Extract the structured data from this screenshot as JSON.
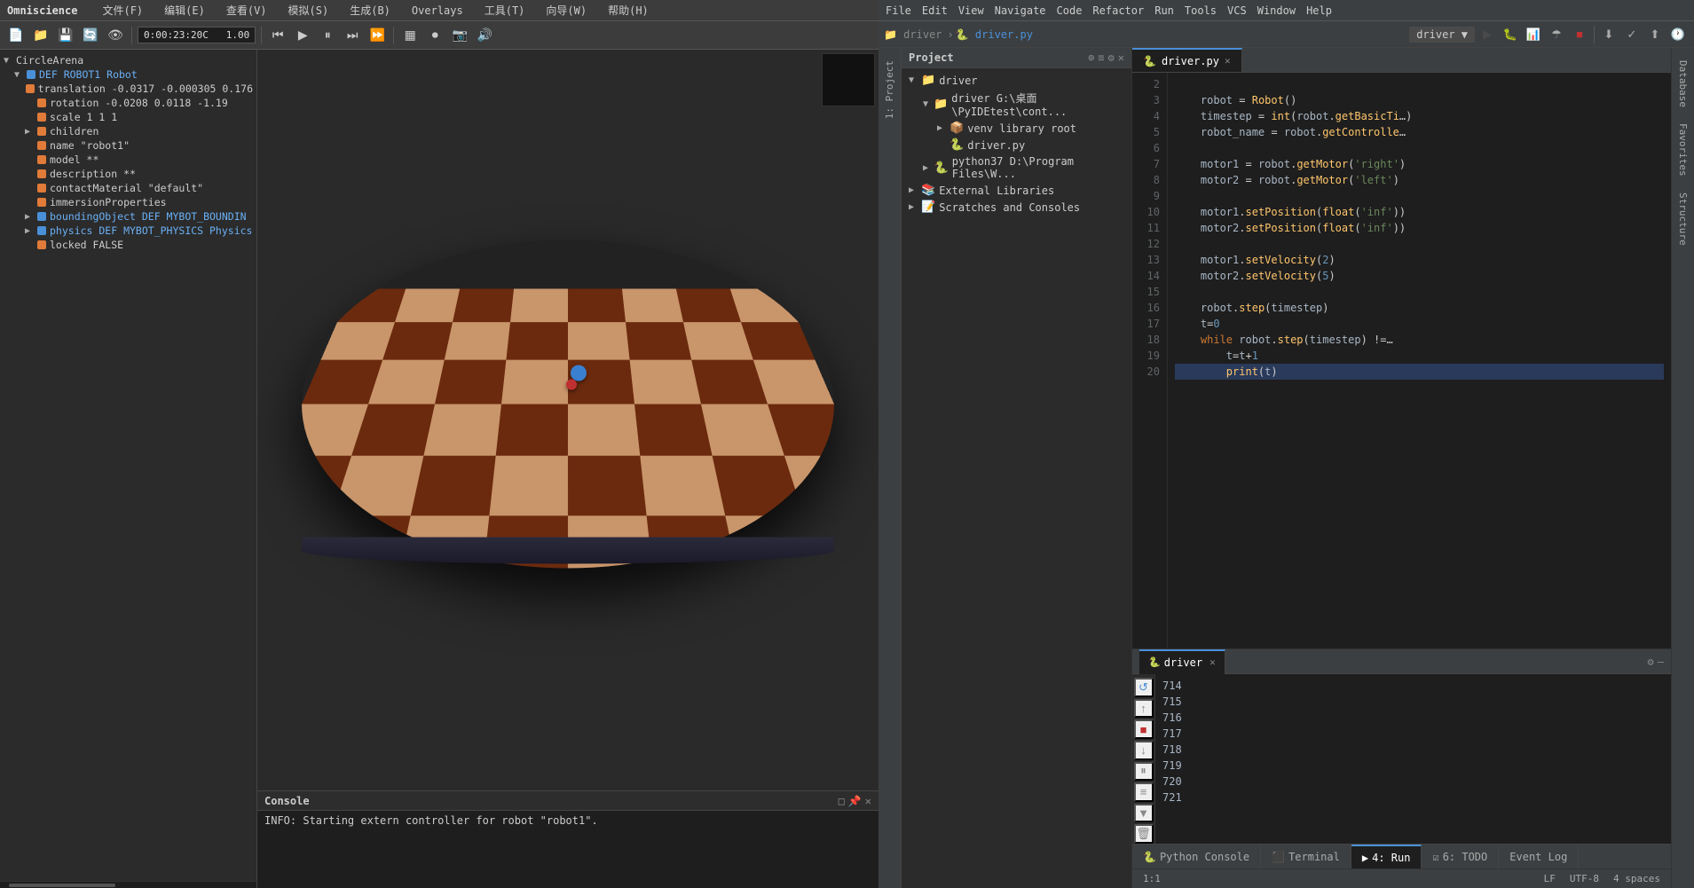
{
  "app": {
    "title": "Omniscience"
  },
  "menu": {
    "items": [
      "文件(F)",
      "编辑(E)",
      "查看(V)",
      "模拟(S)",
      "生成(B)",
      "Overlays",
      "工具(T)",
      "向导(W)",
      "帮助(H)"
    ]
  },
  "toolbar": {
    "time": "0:00:23:20",
    "speed": "1.00"
  },
  "left_tree": {
    "items": [
      {
        "id": "circle-arena",
        "label": "CircleArena",
        "level": 0,
        "arrow": "▼",
        "dot": null,
        "color": "default"
      },
      {
        "id": "def-robot1",
        "label": "DEF ROBOT1 Robot",
        "level": 1,
        "arrow": "▼",
        "dot": "blue",
        "color": "blue"
      },
      {
        "id": "translation",
        "label": "translation -0.0317 -0.000305 0.176",
        "level": 2,
        "arrow": "",
        "dot": "orange",
        "color": "default"
      },
      {
        "id": "rotation",
        "label": "rotation -0.0208 0.0118 -1.19",
        "level": 2,
        "arrow": "",
        "dot": "orange",
        "color": "default"
      },
      {
        "id": "scale",
        "label": "scale 1 1 1",
        "level": 2,
        "arrow": "",
        "dot": "orange",
        "color": "default"
      },
      {
        "id": "children",
        "label": "children",
        "level": 2,
        "arrow": "▶",
        "dot": "orange",
        "color": "default"
      },
      {
        "id": "name",
        "label": "name \"robot1\"",
        "level": 2,
        "arrow": "",
        "dot": "orange",
        "color": "default"
      },
      {
        "id": "model",
        "label": "model **",
        "level": 2,
        "arrow": "",
        "dot": "orange",
        "color": "default"
      },
      {
        "id": "description",
        "label": "description **",
        "level": 2,
        "arrow": "",
        "dot": "orange",
        "color": "default"
      },
      {
        "id": "contactMaterial",
        "label": "contactMaterial \"default\"",
        "level": 2,
        "arrow": "",
        "dot": "orange",
        "color": "default"
      },
      {
        "id": "immersionProperties",
        "label": "immersionProperties",
        "level": 2,
        "arrow": "",
        "dot": "orange",
        "color": "default"
      },
      {
        "id": "boundingObject",
        "label": "boundingObject DEF MYBOT_BOUNDIN",
        "level": 2,
        "arrow": "▶",
        "dot": "blue",
        "color": "blue"
      },
      {
        "id": "physics",
        "label": "physics DEF MYBOT_PHYSICS Physics",
        "level": 2,
        "arrow": "▶",
        "dot": "blue",
        "color": "blue"
      },
      {
        "id": "locked",
        "label": "locked FALSE",
        "level": 2,
        "arrow": "",
        "dot": "orange",
        "color": "default"
      }
    ]
  },
  "console": {
    "title": "Console",
    "line": "INFO: Starting extern controller for robot \"robot1\"."
  },
  "pycharm": {
    "menu": [
      "File",
      "Edit",
      "View",
      "Navigate",
      "Code",
      "Refactor",
      "Run",
      "Tools",
      "VCS",
      "Window",
      "Help"
    ],
    "project": {
      "title": "Project",
      "breadcrumb": [
        "driver",
        "driver.py"
      ],
      "driver_path": "driver  G:\\桌面\\PyIDEtest\\cont...",
      "venv": "venv  library root",
      "driver_py": "driver.py",
      "python37": "python37  D:\\Program Files\\W...",
      "external_libs": "External Libraries",
      "scratches": "Scratches and Consoles"
    },
    "editor": {
      "tab": "driver.py",
      "lines": [
        {
          "num": 2,
          "text": ""
        },
        {
          "num": 3,
          "text": "    robot = Robot()"
        },
        {
          "num": 4,
          "text": "    timestep = int(robot.getBasicTi..."
        },
        {
          "num": 5,
          "text": "    robot_name = robot.getControlle..."
        },
        {
          "num": 6,
          "text": ""
        },
        {
          "num": 7,
          "text": "    motor1 = robot.getMotor('right'..."
        },
        {
          "num": 8,
          "text": "    motor2 = robot.getMotor('left'..."
        },
        {
          "num": 9,
          "text": ""
        },
        {
          "num": 10,
          "text": "    motor1.setPosition(float('inf')"
        },
        {
          "num": 11,
          "text": "    motor2.setPosition(float('inf')"
        },
        {
          "num": 12,
          "text": ""
        },
        {
          "num": 13,
          "text": "    motor1.setVelocity(2)"
        },
        {
          "num": 14,
          "text": "    motor2.setVelocity(5)"
        },
        {
          "num": 15,
          "text": ""
        },
        {
          "num": 16,
          "text": "    robot.step(timestep)"
        },
        {
          "num": 17,
          "text": "    t=0"
        },
        {
          "num": 18,
          "text": "    while robot.step(timestep) !=..."
        },
        {
          "num": 19,
          "text": "        t=t+1"
        },
        {
          "num": 20,
          "text": "        print(t)"
        }
      ]
    },
    "run": {
      "title": "driver",
      "lines": [
        "714",
        "715",
        "716",
        "717",
        "718",
        "719",
        "720",
        "721"
      ]
    },
    "bottom_tabs": [
      {
        "label": "Python Console",
        "num": ""
      },
      {
        "label": "Terminal",
        "num": ""
      },
      {
        "label": "4: Run",
        "num": "4",
        "active": true
      },
      {
        "label": "6: TODO",
        "num": "6"
      },
      {
        "label": "Event Log",
        "num": ""
      }
    ],
    "status_bar": {
      "position": "1:1",
      "line_ending": "LF",
      "encoding": "UTF-8",
      "indent": "4 spaces"
    },
    "sidebar_right_tabs": [
      "Database",
      "Favorites",
      "Structure"
    ],
    "sidebar_left_tab": "1: Project"
  }
}
